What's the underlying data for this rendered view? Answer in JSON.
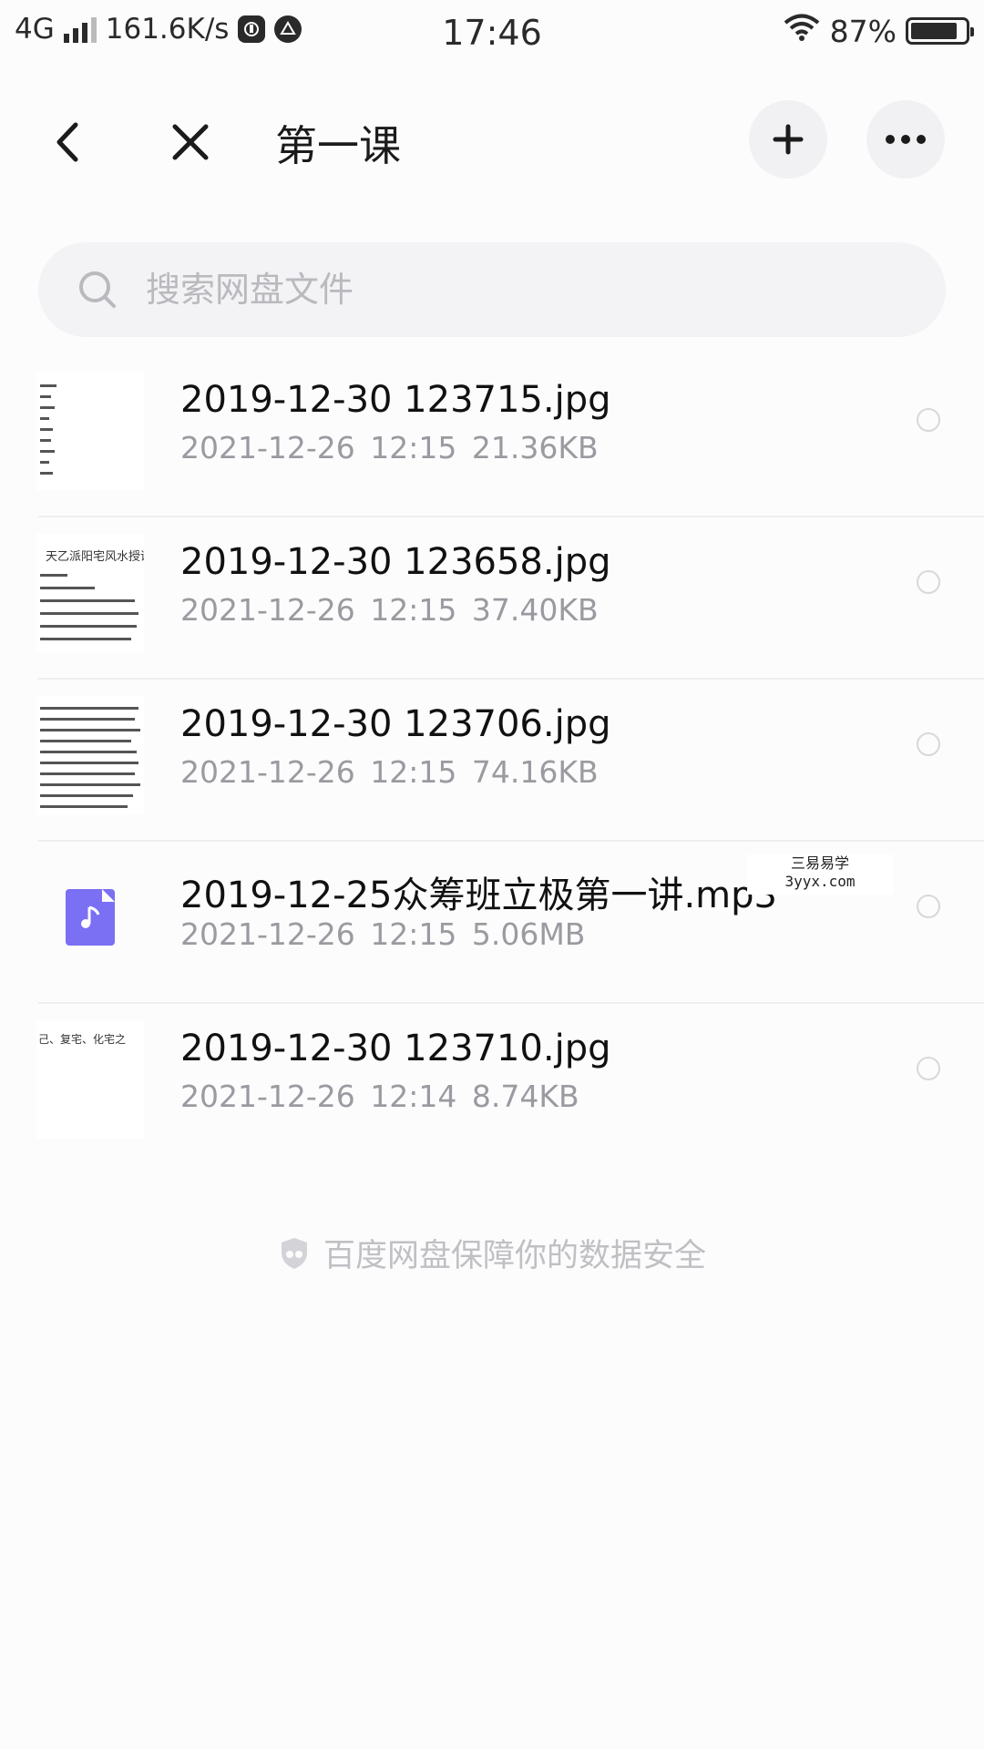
{
  "status_bar": {
    "network": "4G",
    "speed": "161.6K/s",
    "time": "17:46",
    "battery_percent": "87%",
    "battery_level": 0.87
  },
  "nav": {
    "title": "第一课",
    "back_icon": "chevron-left-icon",
    "close_icon": "close-icon",
    "add_icon": "plus-icon",
    "more_icon": "more-horizontal-icon"
  },
  "search": {
    "placeholder": "搜索网盘文件",
    "value": ""
  },
  "files": [
    {
      "name": "2019-12-30 123715.jpg",
      "meta": "2021-12-26  12:15  21.36KB",
      "type": "image",
      "thumb_heading": ""
    },
    {
      "name": "2019-12-30 123658.jpg",
      "meta": "2021-12-26  12:15  37.40KB",
      "type": "image",
      "thumb_heading": "天乙派阳宅风水授课讲义"
    },
    {
      "name": "2019-12-30 123706.jpg",
      "meta": "2021-12-26  12:15  74.16KB",
      "type": "image",
      "thumb_heading": ""
    },
    {
      "name": "2019-12-25众筹班立极第一讲.mp3",
      "meta": "2021-12-26  12:15  5.06MB",
      "type": "audio",
      "thumb_heading": ""
    },
    {
      "name": "2019-12-30 123710.jpg",
      "meta": "2021-12-26  12:14  8.74KB",
      "type": "image",
      "thumb_heading": "己、复宅、化宅之"
    }
  ],
  "watermark": {
    "line1": "三易易学",
    "line2": "3yyx.com"
  },
  "footer": {
    "text": "百度网盘保障你的数据安全",
    "icon": "shield-icon"
  },
  "colors": {
    "accent_audio": "#7b6ff3",
    "meta_gray": "#9a9aa0",
    "background": "#fcfcfd"
  }
}
